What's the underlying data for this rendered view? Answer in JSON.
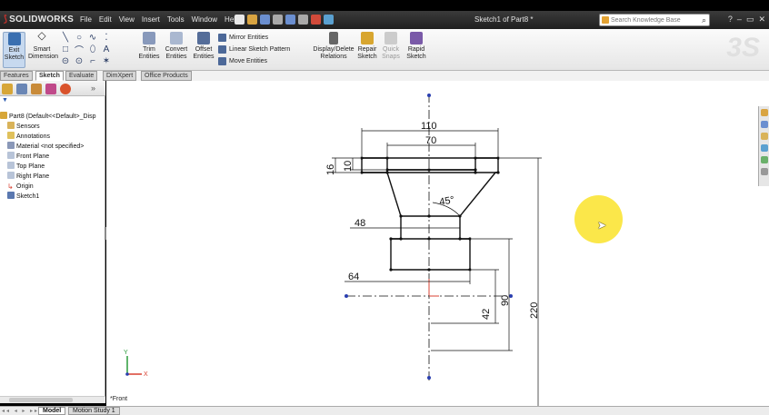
{
  "window": {
    "app_name": "SOLIDWORKS",
    "doc_title": "Sketch1 of Part8 *",
    "menu": [
      "File",
      "Edit",
      "View",
      "Insert",
      "Tools",
      "Window",
      "Help"
    ],
    "search_placeholder": "Search Knowledge Base"
  },
  "ribbon": {
    "exit_sketch": "Exit Sketch",
    "smart_dimension": "Smart Dimension",
    "trim_entities": "Trim Entities",
    "convert_entities": "Convert Entities",
    "offset_entities": "Offset Entities",
    "mirror_entities": "Mirror Entities",
    "linear_sketch_pattern": "Linear Sketch Pattern",
    "move_entities": "Move Entities",
    "display_delete_relations": "Display/Delete Relations",
    "repair_sketch": "Repair Sketch",
    "quick_snaps": "Quick Snaps",
    "rapid_sketch": "Rapid Sketch"
  },
  "tabs": [
    "Features",
    "Sketch",
    "Evaluate",
    "DimXpert",
    "Office Products"
  ],
  "active_tab": "Sketch",
  "feature_tree": {
    "root": "Part8  (Default<<Default>_Disp",
    "items": [
      "Sensors",
      "Annotations",
      "Material <not specified>",
      "Front Plane",
      "Top Plane",
      "Right Plane",
      "Origin",
      "Sketch1"
    ]
  },
  "sketch": {
    "dimensions": {
      "overall_width": "110",
      "top_width": "70",
      "height_16": "16",
      "height_10": "10",
      "angle": "45°",
      "neck_width": "48",
      "base_width": "64",
      "height_42": "42",
      "height_90": "90",
      "height_220": "220"
    },
    "triad": {
      "x": "X",
      "y": "Y"
    }
  },
  "view_label": "*Front",
  "bottom_tabs": [
    "Model",
    "Motion Study 1"
  ],
  "colors": {
    "highlight": "#fbe74a",
    "origin": "#d94030",
    "axis_point": "#2a3fb0"
  }
}
